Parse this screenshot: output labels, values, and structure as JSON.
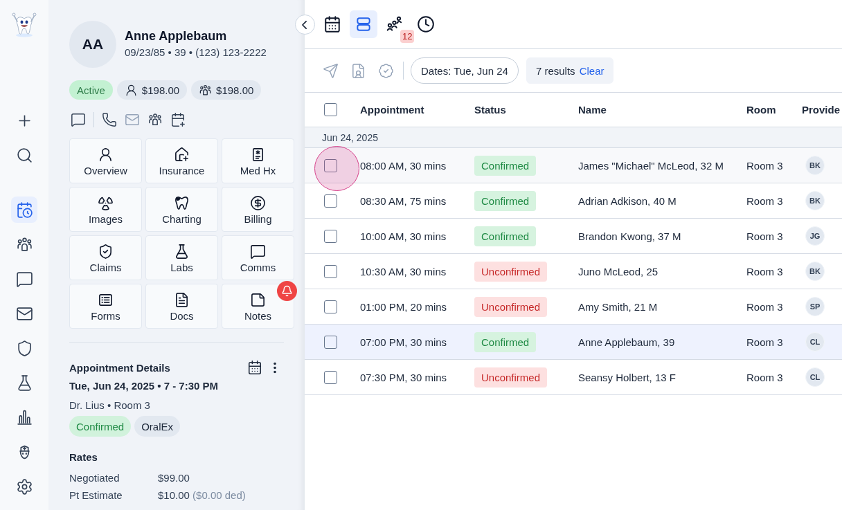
{
  "rail": {
    "actions": [
      {
        "kind": "add"
      },
      {
        "kind": "search"
      }
    ],
    "items": [
      {
        "kind": "schedule",
        "selected": true
      },
      {
        "kind": "patients",
        "selected": false
      },
      {
        "kind": "chat",
        "selected": false
      },
      {
        "kind": "mail",
        "selected": false
      },
      {
        "kind": "insurance",
        "selected": false
      },
      {
        "kind": "labs",
        "selected": false
      },
      {
        "kind": "reports",
        "selected": false
      },
      {
        "kind": "staff",
        "selected": false
      },
      {
        "kind": "settings",
        "selected": false
      }
    ]
  },
  "patient": {
    "initials": "AA",
    "name": "Anne Applebaum",
    "details": "09/23/85 • 39 • (123) 123-2222",
    "status": {
      "label": "Active",
      "active": true
    },
    "balances": [
      {
        "kind": "patient",
        "amount": "$198.00"
      },
      {
        "kind": "family",
        "amount": "$198.00"
      }
    ],
    "contact_actions": [
      {
        "kind": "chat",
        "disabled": false
      },
      {
        "kind": "phone",
        "disabled": false
      },
      {
        "kind": "mail",
        "disabled": true
      },
      {
        "kind": "family",
        "disabled": false
      },
      {
        "kind": "schedule",
        "disabled": false
      }
    ]
  },
  "tiles": [
    {
      "label": "Overview",
      "kind": "overview",
      "alert": false
    },
    {
      "label": "Insurance",
      "kind": "insurance",
      "alert": false
    },
    {
      "label": "Med Hx",
      "kind": "medhx",
      "alert": false
    },
    {
      "label": "Images",
      "kind": "images",
      "alert": false
    },
    {
      "label": "Charting",
      "kind": "charting",
      "alert": false
    },
    {
      "label": "Billing",
      "kind": "billing",
      "alert": false
    },
    {
      "label": "Claims",
      "kind": "claims",
      "alert": false
    },
    {
      "label": "Labs",
      "kind": "labs",
      "alert": false
    },
    {
      "label": "Comms",
      "kind": "comms",
      "alert": false
    },
    {
      "label": "Forms",
      "kind": "forms",
      "alert": false
    },
    {
      "label": "Docs",
      "kind": "docs",
      "alert": false
    },
    {
      "label": "Notes",
      "kind": "notes",
      "alert": true
    }
  ],
  "appointment": {
    "title": "Appointment Details",
    "date_time": "Tue, Jun 24, 2025 • 7 - 7:30 PM",
    "provider_room": "Dr. Lius • Room 3",
    "status": {
      "label": "Confirmed",
      "confirmed": true
    },
    "procedure": "OralEx"
  },
  "rates": {
    "title": "Rates",
    "rows": [
      {
        "label": "Negotiated",
        "value": "$99.00"
      },
      {
        "label": "Pt Estimate",
        "value": "$10.00",
        "note": "($0.00 ded)"
      }
    ]
  },
  "views": [
    {
      "kind": "calendar",
      "selected": false
    },
    {
      "kind": "list",
      "selected": true
    },
    {
      "kind": "queue",
      "selected": false,
      "badge": "12"
    },
    {
      "kind": "history",
      "selected": false
    }
  ],
  "filter_bar": {
    "actions": [
      {
        "kind": "send",
        "disabled": true
      },
      {
        "kind": "document",
        "disabled": true
      },
      {
        "kind": "verify",
        "disabled": true
      }
    ],
    "date_filter": "Dates: Tue, Jun 24",
    "results": "7 results",
    "clear": "Clear"
  },
  "table": {
    "all_checked": false,
    "columns": [
      "Appointment",
      "Status",
      "Name",
      "Room",
      "Provide"
    ],
    "groups": [
      {
        "label": "Jun 24, 2025",
        "rows": [
          {
            "checked": false,
            "focused": true,
            "selected": false,
            "appointment": "08:00 AM, 30 mins",
            "status": "Confirmed",
            "confirmed": true,
            "name": "James \"Michael\" McLeod, 32 M",
            "room": "Room 3",
            "provider": "BK"
          },
          {
            "checked": false,
            "focused": false,
            "selected": false,
            "appointment": "08:30 AM, 75 mins",
            "status": "Confirmed",
            "confirmed": true,
            "name": "Adrian Adkison, 40 M",
            "room": "Room 3",
            "provider": "BK"
          },
          {
            "checked": false,
            "focused": false,
            "selected": false,
            "appointment": "10:00 AM, 30 mins",
            "status": "Confirmed",
            "confirmed": true,
            "name": "Brandon Kwong, 37 M",
            "room": "Room 3",
            "provider": "JG"
          },
          {
            "checked": false,
            "focused": false,
            "selected": false,
            "appointment": "10:30 AM, 30 mins",
            "status": "Unconfirmed",
            "confirmed": false,
            "name": "Juno McLeod, 25",
            "room": "Room 3",
            "provider": "BK"
          },
          {
            "checked": false,
            "focused": false,
            "selected": false,
            "appointment": "01:00 PM, 20 mins",
            "status": "Unconfirmed",
            "confirmed": false,
            "name": "Amy Smith, 21 M",
            "room": "Room 3",
            "provider": "SP"
          },
          {
            "checked": false,
            "focused": false,
            "selected": true,
            "appointment": "07:00 PM, 30 mins",
            "status": "Confirmed",
            "confirmed": true,
            "name": "Anne Applebaum, 39",
            "room": "Room 3",
            "provider": "CL"
          },
          {
            "checked": false,
            "focused": false,
            "selected": false,
            "appointment": "07:30 PM, 30 mins",
            "status": "Unconfirmed",
            "confirmed": false,
            "name": "Seansy Holbert, 13 F",
            "room": "Room 3",
            "provider": "CL"
          }
        ]
      }
    ]
  }
}
